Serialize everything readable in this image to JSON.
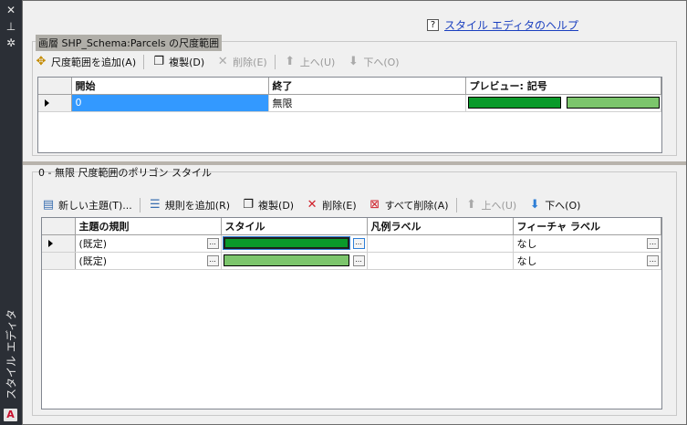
{
  "sidebar": {
    "close_icon": "✕",
    "pin_icon": "⊥",
    "settings_icon": "✲",
    "title": "スタイル エディタ",
    "logo": "A"
  },
  "help": {
    "icon": "?",
    "link": "スタイル エディタのヘルプ"
  },
  "scale_section": {
    "title": "画層 SHP_Schema:Parcels の尺度範囲",
    "toolbar": {
      "add": "尺度範囲を追加(A)",
      "copy": "複製(D)",
      "delete": "削除(E)",
      "up": "上へ(U)",
      "down": "下へ(O)"
    },
    "columns": [
      "開始",
      "終了",
      "プレビュー: 記号"
    ],
    "rows": [
      {
        "start": "0",
        "end": "無限",
        "preview_colors": [
          "#0a9a2a",
          "#7cc56c"
        ]
      }
    ]
  },
  "polygon_section": {
    "title": "0 - 無限 尺度範囲のポリゴン スタイル",
    "toolbar": {
      "new_theme": "新しい主題(T)...",
      "add_rule": "規則を追加(R)",
      "copy": "複製(D)",
      "delete": "削除(E)",
      "delete_all": "すべて削除(A)",
      "up": "上へ(U)",
      "down": "下へ(O)"
    },
    "columns": [
      "主題の規則",
      "スタイル",
      "凡例ラベル",
      "フィーチャ ラベル"
    ],
    "rows": [
      {
        "rule": "(既定)",
        "style_color": "#0a9a2a",
        "legend": "",
        "feature": "なし"
      },
      {
        "rule": "(既定)",
        "style_color": "#7cc56c",
        "legend": "",
        "feature": "なし"
      }
    ],
    "ellipsis": "..."
  }
}
